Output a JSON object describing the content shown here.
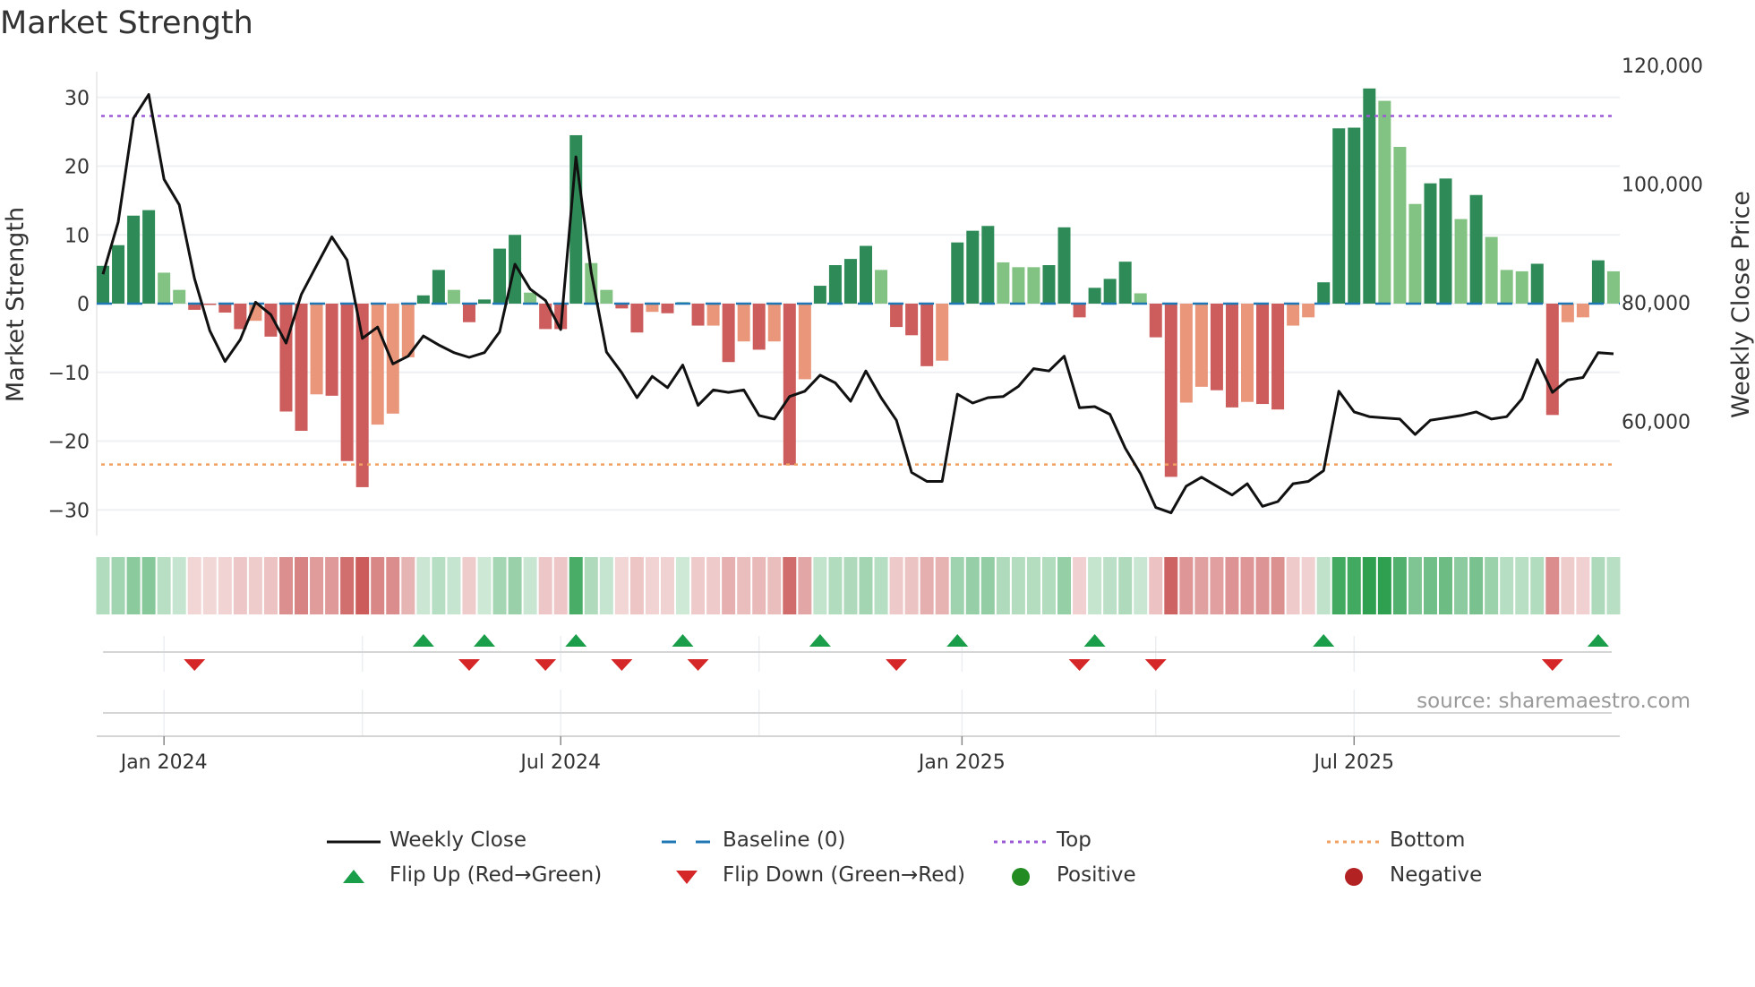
{
  "title": "Market Strength",
  "source": "source: sharemaestro.com",
  "colors": {
    "bar_dark_green": "#2e8b57",
    "bar_light_green": "#82c282",
    "bar_red": "#cd5c5c",
    "bar_salmon": "#e9967a",
    "line": "#111111",
    "baseline": "#1f77b4",
    "top": "#9b59d6",
    "bottom": "#f0a060",
    "flip_up": "#1a9e4a",
    "flip_down": "#d62728",
    "positive": "#228b22",
    "negative": "#b22222"
  },
  "chart_data": {
    "type": "bar+line",
    "title": "Market Strength",
    "ylabel": "Market Strength",
    "y2label": "Weekly Close Price",
    "ylim": [
      -33,
      33
    ],
    "y2lim": [
      43000,
      123000
    ],
    "yticks": [
      "30",
      "20",
      "10",
      "0",
      "−10",
      "−20",
      "−30"
    ],
    "ytick_values": [
      30,
      20,
      10,
      0,
      -10,
      -20,
      -30
    ],
    "y2ticks": [
      "120,000",
      "100,000",
      "80,000",
      "60,000"
    ],
    "y2tick_values": [
      120000,
      100000,
      80000,
      60000
    ],
    "xticks": [
      "Jan 2024",
      "Jul 2024",
      "Jan 2025",
      "Jul 2025"
    ],
    "xtick_week_index": [
      4,
      30,
      56.3,
      82
    ],
    "month_grid_week_index": [
      4,
      17,
      30,
      43,
      56.3,
      69,
      82
    ],
    "top_level": 27.3,
    "bottom_level": -23.4,
    "baseline": 0,
    "strength": [
      5.5,
      8.5,
      12.8,
      13.6,
      4.5,
      2,
      -0.9,
      -0.2,
      -1.3,
      -3.7,
      -2.5,
      -4.8,
      -15.7,
      -18.5,
      -13.2,
      -13.4,
      -22.9,
      -26.7,
      -17.6,
      -16,
      -7.8,
      1.2,
      4.9,
      2,
      -2.7,
      0.6,
      8,
      10,
      1.6,
      -3.7,
      -3.7,
      24.5,
      5.9,
      2,
      -0.7,
      -4.2,
      -1.2,
      -1.4,
      0.2,
      -3.2,
      -3.2,
      -8.5,
      -5.5,
      -6.7,
      -5.5,
      -23.5,
      -11,
      2.6,
      5.6,
      6.5,
      8.4,
      4.9,
      -3.4,
      -4.6,
      -9.1,
      -8.3,
      8.9,
      10.6,
      11.3,
      6,
      5.3,
      5.3,
      5.6,
      11.1,
      -2,
      2.3,
      3.6,
      6.1,
      1.5,
      -4.9,
      -25.2,
      -14.4,
      -12.1,
      -12.6,
      -15.1,
      -14.3,
      -14.6,
      -15.4,
      -3.2,
      -2,
      3.1,
      25.5,
      25.6,
      31.3,
      29.5,
      22.8,
      14.5,
      17.5,
      18.2,
      12.3,
      15.8,
      9.7,
      4.9,
      4.7,
      5.8,
      -16.2,
      -2.7,
      -2,
      6.3,
      4.7
    ],
    "shade": [
      "D",
      "D",
      "D",
      "D",
      "L",
      "L",
      "R",
      "R",
      "R",
      "R",
      "S",
      "R",
      "R",
      "R",
      "S",
      "R",
      "R",
      "R",
      "S",
      "S",
      "S",
      "D",
      "D",
      "L",
      "R",
      "D",
      "D",
      "D",
      "L",
      "R",
      "R",
      "D",
      "L",
      "L",
      "R",
      "R",
      "S",
      "R",
      "D",
      "R",
      "S",
      "R",
      "S",
      "R",
      "S",
      "R",
      "S",
      "D",
      "D",
      "D",
      "D",
      "L",
      "R",
      "R",
      "R",
      "S",
      "D",
      "D",
      "D",
      "L",
      "L",
      "L",
      "D",
      "D",
      "R",
      "D",
      "D",
      "D",
      "L",
      "R",
      "R",
      "S",
      "S",
      "R",
      "R",
      "S",
      "R",
      "R",
      "S",
      "S",
      "D",
      "D",
      "D",
      "D",
      "L",
      "L",
      "L",
      "D",
      "D",
      "L",
      "D",
      "L",
      "L",
      "L",
      "D",
      "R",
      "S",
      "S",
      "D",
      "L"
    ],
    "weekly_close": [
      85700,
      94500,
      112000,
      116000,
      101700,
      97400,
      85000,
      76200,
      71000,
      74700,
      81000,
      78900,
      74100,
      82300,
      87200,
      92000,
      88100,
      74900,
      76800,
      70600,
      71900,
      75300,
      73800,
      72500,
      71700,
      72500,
      76000,
      87400,
      83200,
      81300,
      76400,
      105500,
      86000,
      72600,
      69100,
      64900,
      68500,
      66600,
      70400,
      63600,
      66200,
      65800,
      66200,
      61900,
      61300,
      65100,
      66000,
      68700,
      67400,
      64300,
      69400,
      64900,
      61100,
      52300,
      50800,
      50800,
      65500,
      64000,
      64900,
      65100,
      66800,
      69800,
      69400,
      71900,
      63200,
      63400,
      62100,
      56400,
      52100,
      46400,
      45500,
      50000,
      51500,
      50000,
      48500,
      50400,
      46600,
      47400,
      50400,
      50800,
      52600,
      66000,
      62500,
      61700,
      61500,
      61300,
      58700,
      61100,
      61500,
      61900,
      62500,
      61300,
      61700,
      64700,
      71300,
      65800,
      67900,
      68300,
      72500,
      72300
    ],
    "flip_up_weeks": [
      21,
      25,
      31,
      38,
      47,
      56,
      65,
      80,
      98
    ],
    "flip_down_weeks": [
      6,
      24,
      29,
      34,
      39,
      52,
      64,
      69,
      95
    ]
  },
  "legend": [
    {
      "label": "Weekly Close",
      "symbol": "line"
    },
    {
      "label": "Baseline (0)",
      "symbol": "dash"
    },
    {
      "label": "Top",
      "symbol": "dot-top"
    },
    {
      "label": "Bottom",
      "symbol": "dot-bottom"
    },
    {
      "label": "Flip Up (Red→Green)",
      "symbol": "tri-up"
    },
    {
      "label": "Flip Down (Green→Red)",
      "symbol": "tri-down"
    },
    {
      "label": "Positive",
      "symbol": "circle-pos"
    },
    {
      "label": "Negative",
      "symbol": "circle-neg"
    }
  ]
}
